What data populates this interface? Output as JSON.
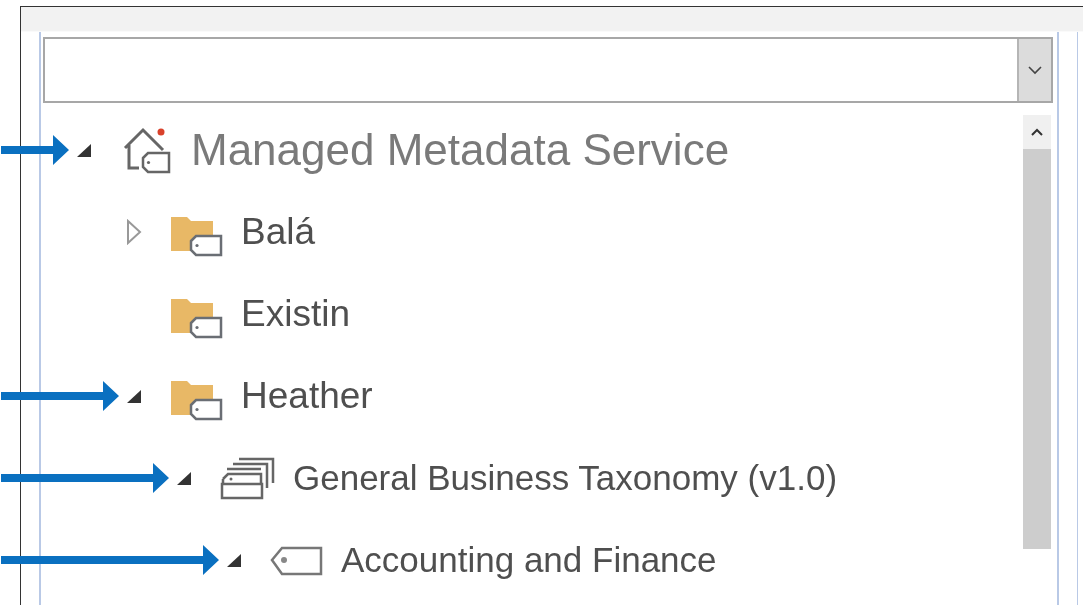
{
  "tree": [
    {
      "kind": "service",
      "label": "Managed Metadata Service",
      "expanded": true,
      "pointer_arrow": true,
      "children": [
        {
          "kind": "group",
          "label": "Balá",
          "expanded": false,
          "pointer_arrow": false
        },
        {
          "kind": "group",
          "label": "Existin",
          "pointer_arrow": false
        },
        {
          "kind": "group",
          "label": "Heather",
          "expanded": true,
          "pointer_arrow": true,
          "children": [
            {
              "kind": "termset",
              "label": "General Business Taxonomy (v1.0)",
              "expanded": true,
              "pointer_arrow": true,
              "children": [
                {
                  "kind": "term",
                  "label": "Accounting and Finance",
                  "expanded": true,
                  "pointer_arrow": true
                }
              ]
            }
          ]
        }
      ]
    }
  ]
}
